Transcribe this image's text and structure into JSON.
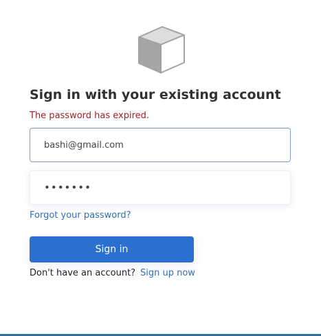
{
  "logo": {
    "icon": "cube-logo-icon"
  },
  "form": {
    "heading": "Sign in with your existing account",
    "error": "The password has expired.",
    "email": {
      "value": "bashi@gmail.com"
    },
    "password": {
      "value": "•••••••"
    },
    "forgot_password": "Forgot your password?",
    "signin_label": "Sign in",
    "no_account": "Don't have an account?",
    "signup_label": "Sign up now"
  },
  "colors": {
    "primary": "#2b6fcf",
    "error": "#a61e22",
    "link": "#2f6fb7",
    "bottom_border": "#2e6da4"
  }
}
